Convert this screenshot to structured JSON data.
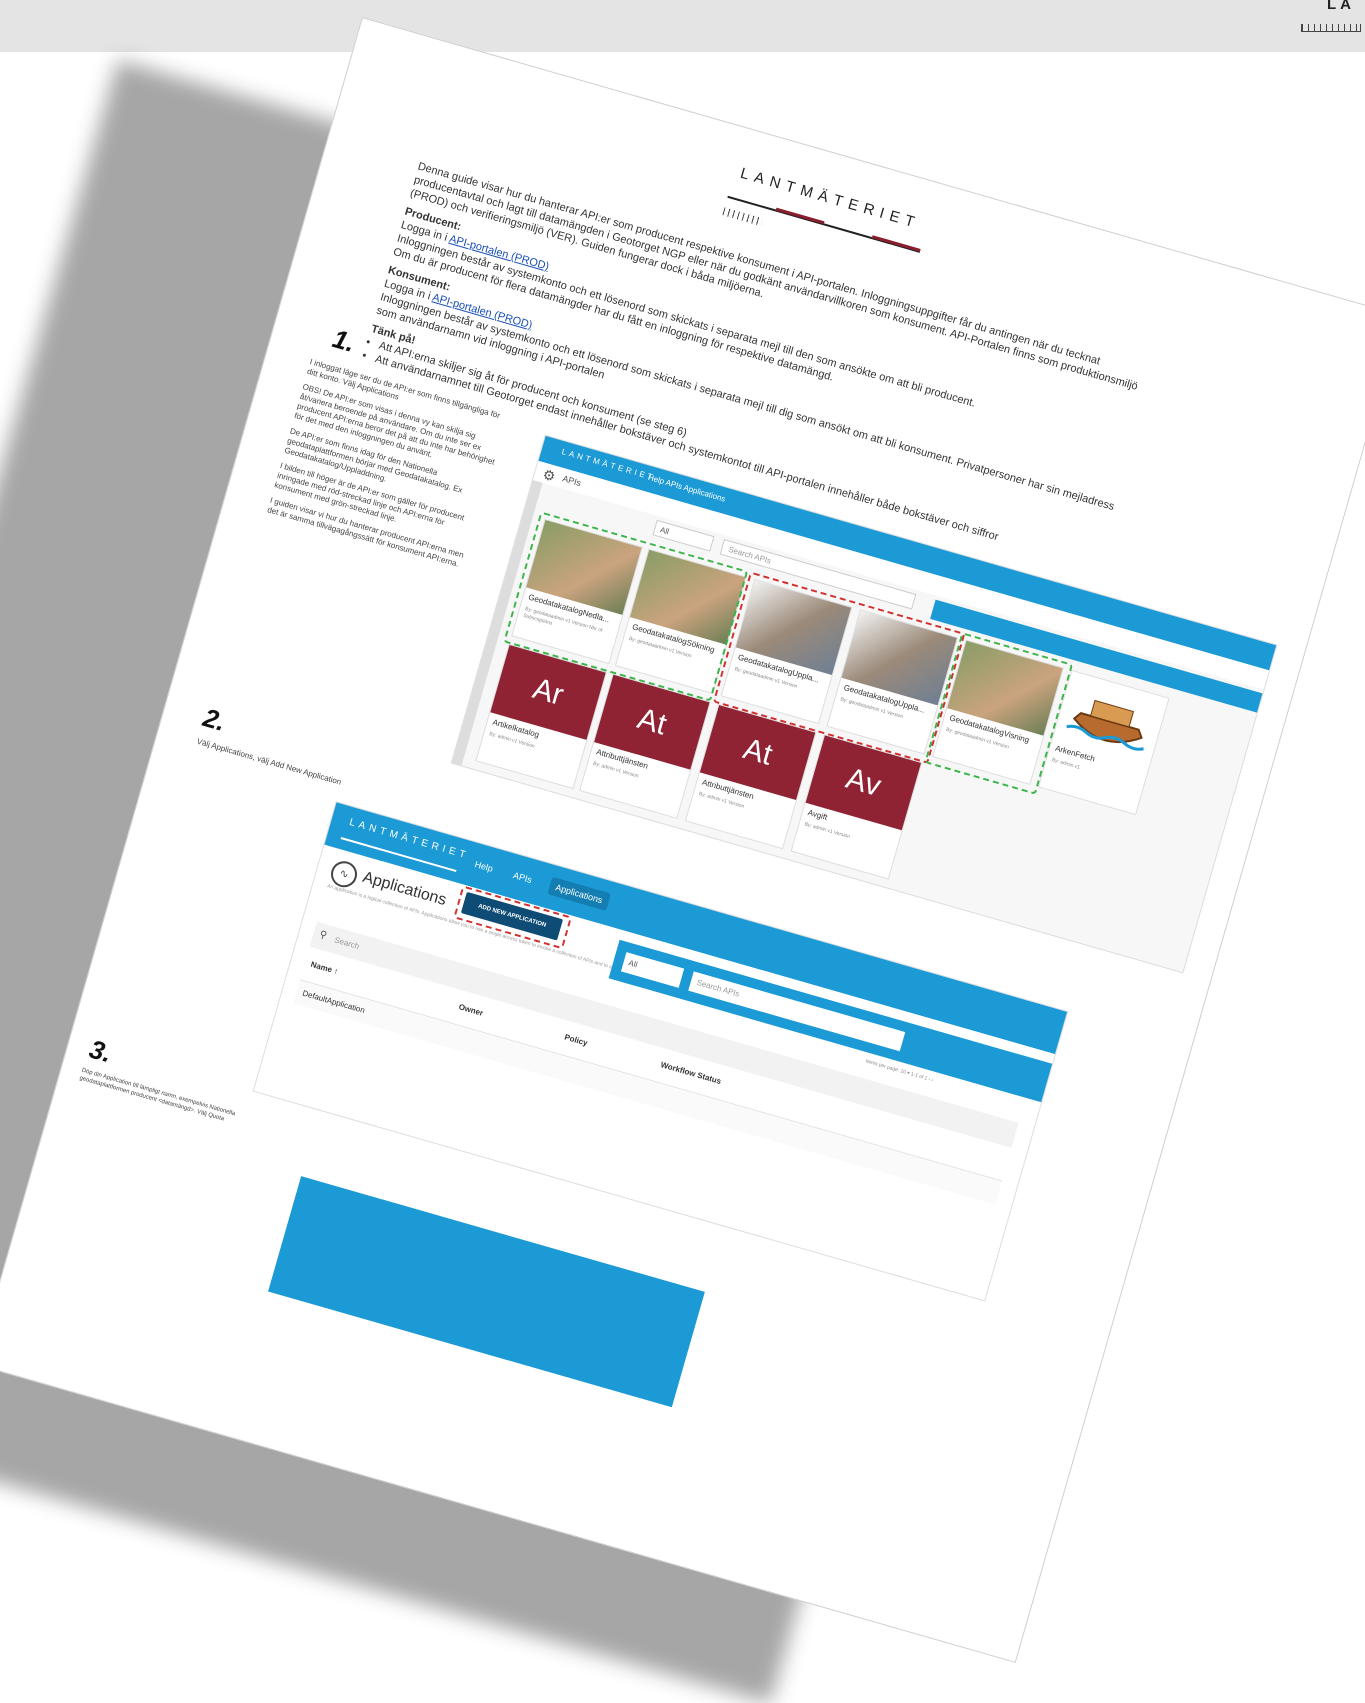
{
  "corner_logo": {
    "text": "LA"
  },
  "sheet": {
    "logo_text": "LANTMÄTERIET",
    "intro": {
      "p1": "Denna guide visar hur du hanterar API:er som producent respektive konsument i API-portalen. Inloggningsuppgifter får du antingen när du tecknat producentavtal och lagt till datamängden i Geotorget NGP eller när du godkänt användarvillkoren som konsument. API-Portalen finns som produktionsmiljö (PROD) och verifieringsmiljö (VER). Guiden fungerar dock i båda miljöerna.",
      "producent_heading": "Producent:",
      "producent_login_prefix": "Logga in i",
      "producent_link": "API-portalen (PROD)",
      "producent_l2": "Inloggningen består av systemkonto och ett lösenord som skickats i separata mejl till den som ansökte om att bli producent.",
      "producent_l3": "Om du är producent för flera datamängder har du fått en inloggning för respektive datamängd.",
      "konsument_heading": "Konsument:",
      "konsument_login_prefix": "Logga in i",
      "konsument_link": "API-portalen  (PROD)",
      "konsument_l2": "Inloggningen består av systemkonto och ett lösenord som skickats i separata mejl till dig som ansökt om att bli konsument. Privatpersoner har sin mejladress som användarnamn vid inloggning i API-portalen",
      "tank_heading": "Tänk på!",
      "bullet1": "Att API:erna skiljer sig åt för producent och konsument (se steg 6)",
      "bullet2": "Att användarnamnet till Geotorget endast innehåller bokstäver och systemkontot till API-portalen innehåller både bokstäver och siffror"
    },
    "step1": {
      "num": "1.",
      "p1": "I inloggat läge ser du de API:er som finns tillgängliga för ditt konto. Välj Applications",
      "p2": "OBS! De API:er som visas i denna vy kan skilja sig åt/variera beroende på användare. Om du inte ser ex producent API:erna beror det på att du inte har behörighet för det med den inloggningen du använt.",
      "p3": "De API:er som finns idag för den Nationella geodataplattformen börjar med Geodatakatalog. Ex Geodatakatalog/Uppladdning.",
      "p4": "I bilden till höger är de API:er som gäller för producent inringade med röd-streckad linje och API:erna för konsument med grön-streckad linje.",
      "p5": "I guiden visar vi hur du hanterar producent API:erna men det är samma tillvägagångssätt för konsument API:erna."
    },
    "step2": {
      "num": "2.",
      "text": "Välj Applications, välj Add New Application"
    },
    "step3": {
      "num": "3.",
      "text": "Döp din Application till lämpligt namn, exempelvis Nationella geodataplattformen producent <datamängd>. Välj Quota"
    },
    "shot1": {
      "logo": "LANTMÄTERIET",
      "nav": "Help   APIs   Applications",
      "section": "APIs",
      "filter": "All",
      "search_placeholder": "Search APIs",
      "cards": [
        {
          "title": "GeodatakatalogNedla...",
          "kind": "nature",
          "meta": "By: geodataadmin  v1  Version  Nbr of Subscriptions"
        },
        {
          "title": "GeodatakatalogSökning",
          "kind": "nature",
          "meta": "By: geodataadmin  v1  Version"
        },
        {
          "title": "GeodatakatalogUppla...",
          "kind": "puzzle",
          "meta": "By: geodataadmin  v1  Version"
        },
        {
          "title": "GeodatakatalogUppla...",
          "kind": "puzzle",
          "meta": "By: geodataadmin  v1  Version"
        },
        {
          "title": "GeodatakatalogVisning",
          "kind": "nature",
          "meta": "By: geodataadmin  v1  Version"
        },
        {
          "title": "ArkenFetch",
          "kind": "ark",
          "meta": "By: admin  v1"
        },
        {
          "title": "Artikelkatalog",
          "kind": "red",
          "abbr": "Ar",
          "meta": "By: admin  v1  Version"
        },
        {
          "title": "Attributtjänsten",
          "kind": "red",
          "abbr": "At",
          "meta": "By: admin  v1  Version"
        },
        {
          "title": "Attributtjänsten",
          "kind": "red",
          "abbr": "At",
          "meta": "By: admin  v1  Version"
        },
        {
          "title": "Avgift",
          "kind": "red",
          "abbr": "Av",
          "meta": "By: admin  v1  Version"
        }
      ]
    },
    "shot2": {
      "logo": "LANTMÄTERIET",
      "nav_help": "Help",
      "nav_apis": "APIs",
      "nav_applications": "Applications",
      "title": "Applications",
      "description": "An application is a logical collection of APIs. Applications allow you to use a single access token to invoke a collection of APIs and to subscribe to one API multiple times and allows unlimited access by default.",
      "add_button": "ADD NEW APPLICATION",
      "filter": "All",
      "search_apis_placeholder": "Search APIs",
      "pager": "Items per page: 10  ▾    1-1 of 1    ‹  ›",
      "search_placeholder": "Search",
      "columns": [
        "Name ↑",
        "Owner",
        "Policy",
        "Workflow Status"
      ],
      "rows": [
        {
          "name": "DefaultApplication"
        }
      ]
    }
  },
  "colors": {
    "accent_blue": "#1c9ad6",
    "brand_red": "#8b1e2d",
    "dash_green": "#3bb54a",
    "dash_red": "#d32f2f"
  }
}
